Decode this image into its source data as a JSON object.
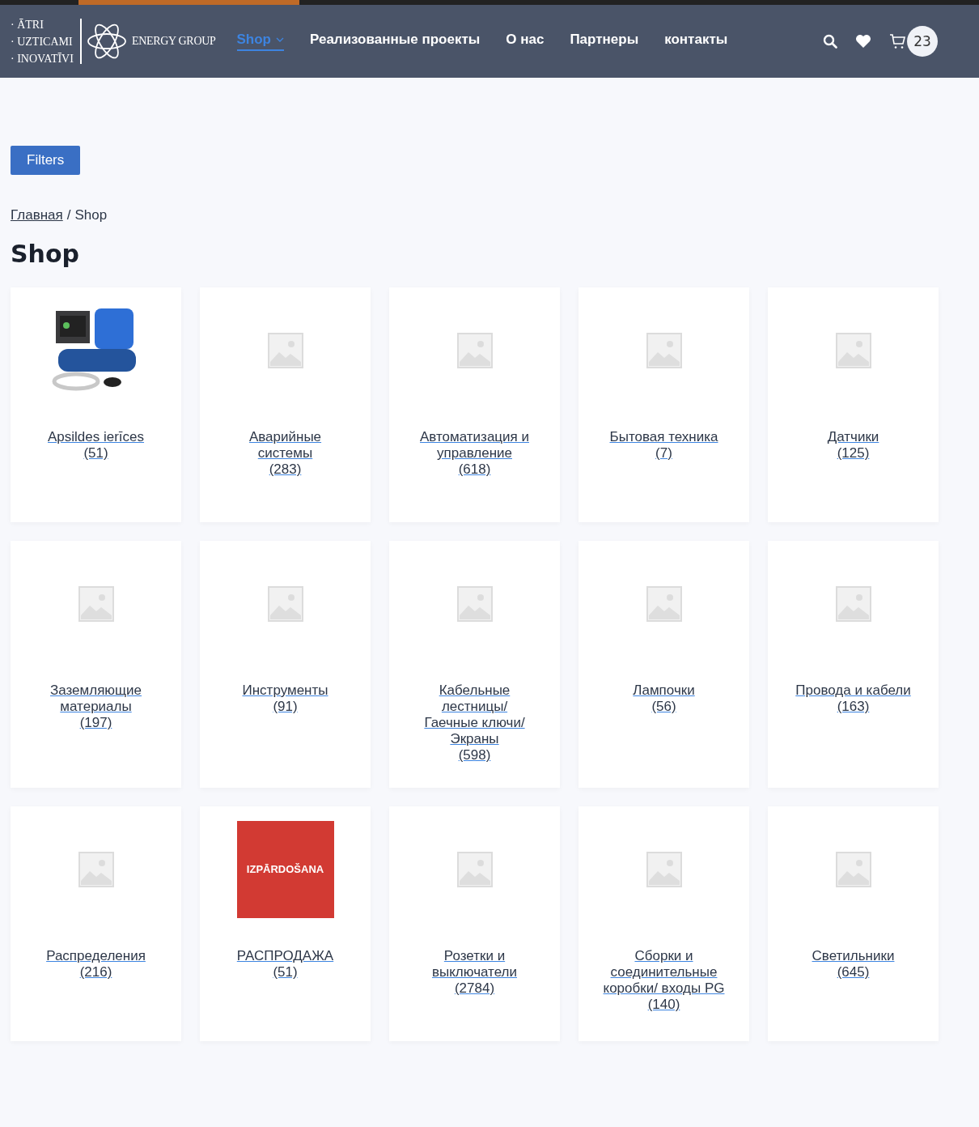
{
  "logo": {
    "taglines": [
      "· ĀTRI",
      "· UZTICAMI",
      "· INOVATĪVI"
    ],
    "brand": "ENERGY GROUP"
  },
  "nav": [
    {
      "label": "Shop",
      "selected": true,
      "dropdown": true
    },
    {
      "label": "Реализованные проекты",
      "selected": false,
      "dropdown": false
    },
    {
      "label": "О нас",
      "selected": false,
      "dropdown": false
    },
    {
      "label": "Партнеры",
      "selected": false,
      "dropdown": false
    },
    {
      "label": "контакты",
      "selected": false,
      "dropdown": false
    }
  ],
  "cart_count": "23",
  "filters_button": "Filters",
  "breadcrumb": {
    "home": "Главная",
    "separator": "/",
    "current": "Shop"
  },
  "title": "Shop",
  "categories": [
    {
      "name": "Apsildes ierīces",
      "count": "(51)",
      "kind": "photo"
    },
    {
      "name": "Аварийные системы",
      "count": "(283)",
      "kind": "placeholder"
    },
    {
      "name": "Автоматизация и управление",
      "count": "(618)",
      "kind": "placeholder"
    },
    {
      "name": "Бытовая техника",
      "count": "(7)",
      "kind": "placeholder"
    },
    {
      "name": "Датчики",
      "count": "(125)",
      "kind": "placeholder"
    },
    {
      "name": "Заземляющие материалы",
      "count": "(197)",
      "kind": "placeholder"
    },
    {
      "name": "Инструменты",
      "count": "(91)",
      "kind": "placeholder"
    },
    {
      "name": "Кабельные лестницы/ Гаечные ключи/ Экраны",
      "count": "(598)",
      "kind": "placeholder"
    },
    {
      "name": "Лампочки",
      "count": "(56)",
      "kind": "placeholder"
    },
    {
      "name": "Провода и кабели",
      "count": "(163)",
      "kind": "placeholder"
    },
    {
      "name": "Распределения",
      "count": "(216)",
      "kind": "placeholder"
    },
    {
      "name": "РАСПРОДАЖА",
      "count": "(51)",
      "kind": "sale",
      "image_text": "IZPĀRDOŠANA"
    },
    {
      "name": "Розетки и выключатели",
      "count": "(2784)",
      "kind": "placeholder"
    },
    {
      "name": "Сборки и соединительные коробки/ входы PG",
      "count": "(140)",
      "kind": "placeholder"
    },
    {
      "name": "Светильники",
      "count": "(645)",
      "kind": "placeholder"
    }
  ]
}
